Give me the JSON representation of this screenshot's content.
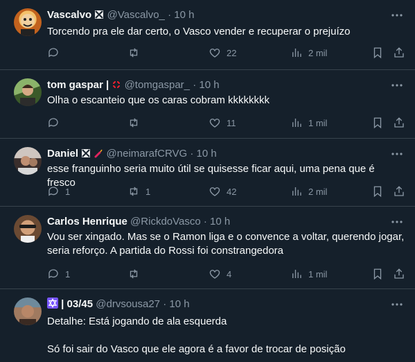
{
  "tweets": [
    {
      "name": "Vascalvo",
      "badge": "ornament",
      "handle": "@Vascalvo_",
      "time": "10 h",
      "text": [
        "Torcendo pra ele dar certo, o Vasco vender e recuperar o prejuízo"
      ],
      "replies": "",
      "retweets": "",
      "likes": "22",
      "views": "2 mil",
      "avatar_colors": [
        "#f0b33a",
        "#d2691e"
      ]
    },
    {
      "name": "tom gaspar |",
      "badge": "anger-symbol",
      "handle": "@tomgaspar_",
      "time": "10 h",
      "text": [
        "Olha o escanteio que os caras cobram kkkkkkkk"
      ],
      "replies": "",
      "retweets": "",
      "likes": "11",
      "views": "1 mil",
      "avatar_colors": [
        "#7aa05a",
        "#3e5e2b"
      ]
    },
    {
      "name": "Daniel",
      "badge": "ornament-firecracker",
      "handle": "@neimarafCRVG",
      "time": "10 h",
      "text": [
        "esse franguinho seria muito útil se quisesse ficar aqui, uma pena que é fresco"
      ],
      "replies": "1",
      "retweets": "1",
      "likes": "42",
      "views": "2 mil",
      "avatar_colors": [
        "#b8a8a0",
        "#4a3a38"
      ]
    },
    {
      "name": "Carlos Henrique",
      "badge": "",
      "handle": "@RickdoVasco",
      "time": "10 h",
      "text": [
        "Vou ser xingado. Mas se o Ramon liga e o convence a voltar, querendo jogar,",
        "seria reforço. A partida do Rossi foi constrangedora"
      ],
      "replies": "1",
      "retweets": "",
      "likes": "4",
      "views": "1 mil",
      "avatar_colors": [
        "#c79a6a",
        "#5a3b2a"
      ]
    },
    {
      "name": "| 03/45",
      "badge": "star-of-david",
      "handle": "@drvsousa27",
      "time": "10 h",
      "text": [
        "Detalhe: Está jogando de ala esquerda",
        "",
        "Só foi sair do Vasco que ele agora é a favor de trocar de posição"
      ],
      "replies": "",
      "retweets": "",
      "likes": "",
      "views": "",
      "avatar_colors": [
        "#a07860",
        "#3a2a22"
      ]
    }
  ],
  "separator": "·",
  "more_icon": "more-dots-icon",
  "colors": {
    "background": "#15202b",
    "divider": "#38444d",
    "text": "#f7f9f9",
    "muted": "#8b98a5"
  }
}
